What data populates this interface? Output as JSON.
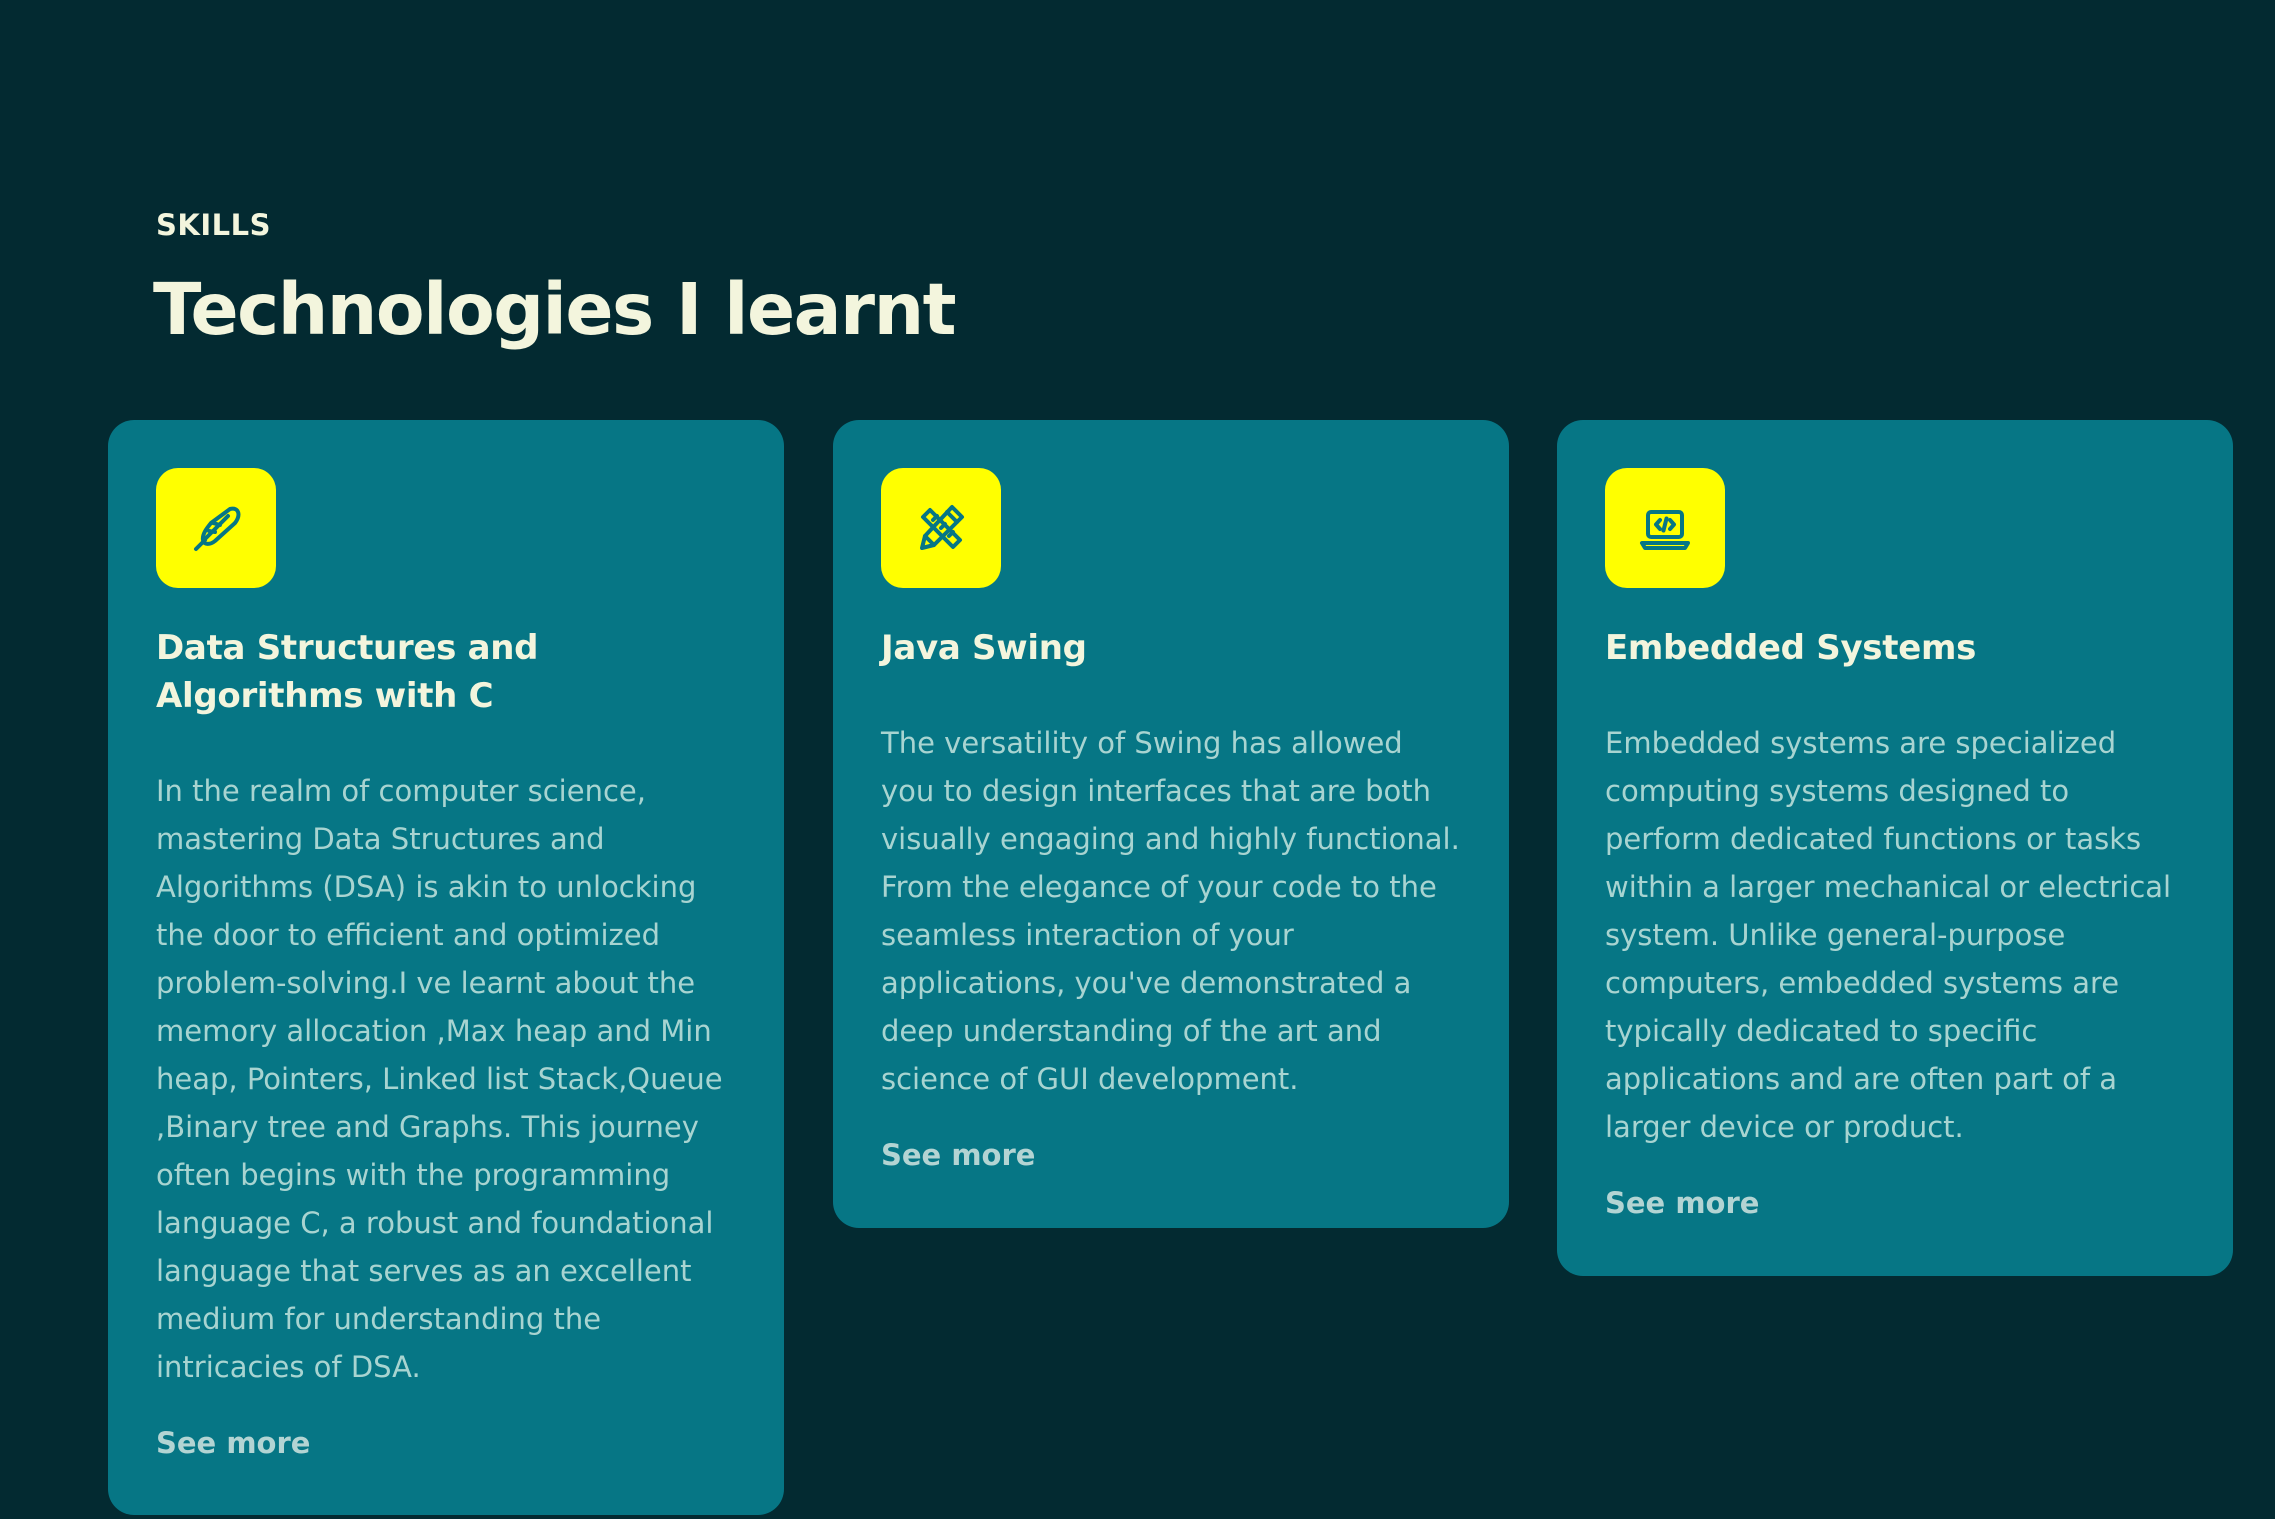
{
  "section": {
    "eyebrow": "SKILLS",
    "heading": "Technologies I learnt"
  },
  "colors": {
    "background": "#032a31",
    "card": "#067685",
    "icon_tile": "#ffff00",
    "icon_stroke": "#067685",
    "heading_text": "#f3f5dd",
    "body_text": "#a8d4d1"
  },
  "cards": [
    {
      "icon": "feather-icon",
      "title": "Data Structures and Algorithms with C",
      "body": "In the realm of computer science, mastering Data Structures and Algorithms (DSA) is akin to unlocking the door to efficient and optimized problem-solving.I ve learnt about the memory allocation ,Max heap and Min heap, Pointers, Linked list Stack,Queue ,Binary tree and Graphs. This journey often begins with the programming language C, a robust and foundational language that serves as an excellent medium for understanding the intricacies of DSA.",
      "link": "See more"
    },
    {
      "icon": "pencil-ruler-icon",
      "title": "Java Swing",
      "body": "The versatility of Swing has allowed you to design interfaces that are both visually engaging and highly functional. From the elegance of your code to the seamless interaction of your applications, you've demonstrated a deep understanding of the art and science of GUI development.",
      "link": "See more"
    },
    {
      "icon": "laptop-code-icon",
      "title": "Embedded Systems",
      "body": "Embedded systems are specialized computing systems designed to perform dedicated functions or tasks within a larger mechanical or electrical system. Unlike general-purpose computers, embedded systems are typically dedicated to specific applications and are often part of a larger device or product.",
      "link": "See more"
    }
  ]
}
